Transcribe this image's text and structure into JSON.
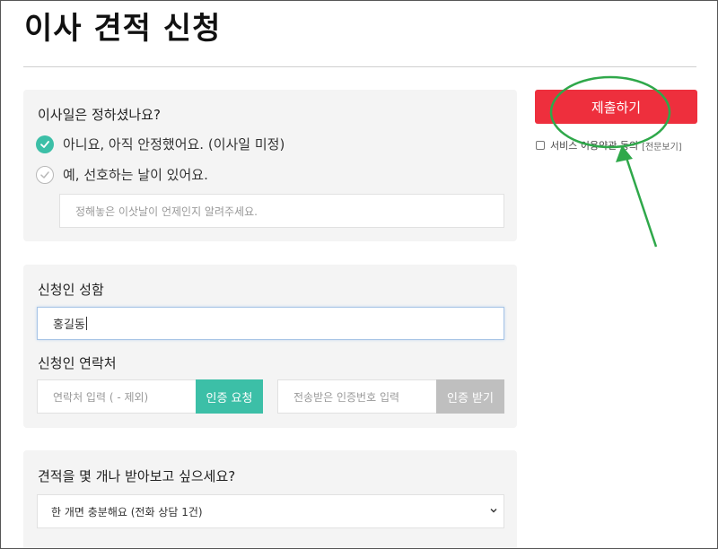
{
  "page": {
    "title": "이사 견적 신청"
  },
  "move_date": {
    "question": "이사일은 정하셨나요?",
    "options": [
      {
        "label": "아니요, 아직 안정했어요. (이사일 미정)",
        "checked": true
      },
      {
        "label": "예, 선호하는 날이 있어요.",
        "checked": false
      }
    ],
    "date_placeholder": "정해놓은 이삿날이 언제인지 알려주세요."
  },
  "applicant": {
    "name_label": "신청인 성함",
    "name_value": "홍길동",
    "contact_label": "신청인 연락처",
    "phone_placeholder": "연락처 입력 ( - 제외)",
    "request_verify_label": "인증 요청",
    "code_placeholder": "전송받은 인증번호 입력",
    "receive_verify_label": "인증 받기"
  },
  "estimate": {
    "question": "견적을 몇 개나 받아보고 싶으세요?",
    "selected_option": "한 개면 충분해요 (전화 상담 1건)"
  },
  "sidebar": {
    "submit_label": "제출하기",
    "agree_label": "서비스 이용약관 동의",
    "agree_link": "[전문보기]",
    "agree_checked": false
  },
  "colors": {
    "accent_green": "#3cbfa7",
    "submit_red": "#ee2f3d",
    "annotation_green": "#2fa84a",
    "disabled_gray": "#bfbfbf"
  }
}
